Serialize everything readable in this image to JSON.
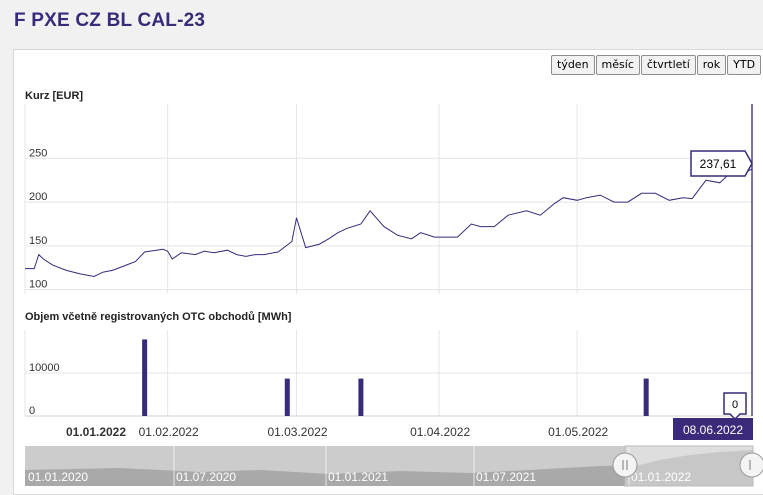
{
  "page": {
    "title": "F PXE CZ BL CAL-23"
  },
  "range_buttons": [
    {
      "label": "týden"
    },
    {
      "label": "měsíc"
    },
    {
      "label": "čtvrtletí"
    },
    {
      "label": "rok"
    },
    {
      "label": "YTD"
    }
  ],
  "colors": {
    "series": "#3a2a7a",
    "accent": "#3a2a7a",
    "grid": "#e4e4e4",
    "navigator_fill": "#a9a9a9"
  },
  "chart_data": [
    {
      "type": "line",
      "title": "Kurz [EUR]",
      "ylim": [
        95,
        312
      ],
      "yticks": [
        100,
        150,
        200,
        250
      ],
      "last_value_label": "237,61",
      "x_start": "2022-01-01",
      "x_end": "2022-06-08",
      "x_tick_labels": [
        {
          "date": "2022-01-01",
          "label": "01.01.2022"
        },
        {
          "date": "2022-02-01",
          "label": "01.02.2022"
        },
        {
          "date": "2022-03-01",
          "label": "01.03.2022"
        },
        {
          "date": "2022-04-01",
          "label": "01.04.2022"
        },
        {
          "date": "2022-05-01",
          "label": "01.05.2022"
        }
      ],
      "range_end_label": "08.06.2022",
      "series": [
        {
          "x": [
            "2022-01-01",
            "2022-01-03",
            "2022-01-04",
            "2022-01-05",
            "2022-01-07",
            "2022-01-10",
            "2022-01-13",
            "2022-01-16",
            "2022-01-18",
            "2022-01-20",
            "2022-01-23",
            "2022-01-25",
            "2022-01-27",
            "2022-01-31",
            "2022-02-01",
            "2022-02-02",
            "2022-02-04",
            "2022-02-07",
            "2022-02-09",
            "2022-02-11",
            "2022-02-14",
            "2022-02-16",
            "2022-02-18",
            "2022-02-20",
            "2022-02-22",
            "2022-02-24",
            "2022-02-25",
            "2022-02-28",
            "2022-03-01",
            "2022-03-03",
            "2022-03-06",
            "2022-03-08",
            "2022-03-10",
            "2022-03-12",
            "2022-03-15",
            "2022-03-17",
            "2022-03-20",
            "2022-03-23",
            "2022-03-26",
            "2022-03-28",
            "2022-03-31",
            "2022-04-01",
            "2022-04-03",
            "2022-04-05",
            "2022-04-08",
            "2022-04-10",
            "2022-04-13",
            "2022-04-16",
            "2022-04-20",
            "2022-04-23",
            "2022-04-26",
            "2022-04-28",
            "2022-05-01",
            "2022-05-03",
            "2022-05-06",
            "2022-05-09",
            "2022-05-12",
            "2022-05-15",
            "2022-05-18",
            "2022-05-21",
            "2022-05-24",
            "2022-05-26",
            "2022-05-29",
            "2022-06-01",
            "2022-06-03",
            "2022-06-05",
            "2022-06-08"
          ],
          "y": [
            124,
            124,
            140,
            135,
            128,
            122,
            118,
            115,
            120,
            122,
            128,
            132,
            143,
            146,
            144,
            135,
            142,
            140,
            144,
            142,
            145,
            140,
            138,
            140,
            140,
            142,
            143,
            155,
            182,
            148,
            152,
            158,
            165,
            170,
            175,
            190,
            172,
            162,
            158,
            165,
            160,
            160,
            160,
            160,
            175,
            172,
            172,
            185,
            190,
            185,
            198,
            205,
            202,
            205,
            208,
            200,
            200,
            210,
            210,
            202,
            205,
            204,
            225,
            222,
            232,
            230,
            237.61
          ]
        }
      ]
    },
    {
      "type": "bar",
      "title": "Objem včetně registrovaných OTC obchodů [MWh]",
      "ylim": [
        0,
        20000
      ],
      "yticks": [
        0,
        10000
      ],
      "last_value_label": "0",
      "series": [
        {
          "x": [
            "2022-01-27",
            "2022-02-27",
            "2022-03-15",
            "2022-05-16"
          ],
          "y": [
            17800,
            8700,
            8700,
            8700
          ]
        }
      ]
    }
  ],
  "navigator": {
    "labels": [
      "01.01.2020",
      "01.07.2020",
      "01.01.2021",
      "01.07.2021",
      "01.01.2022"
    ],
    "selected_from": "2022-01-01",
    "selected_to": "2022-06-08"
  }
}
